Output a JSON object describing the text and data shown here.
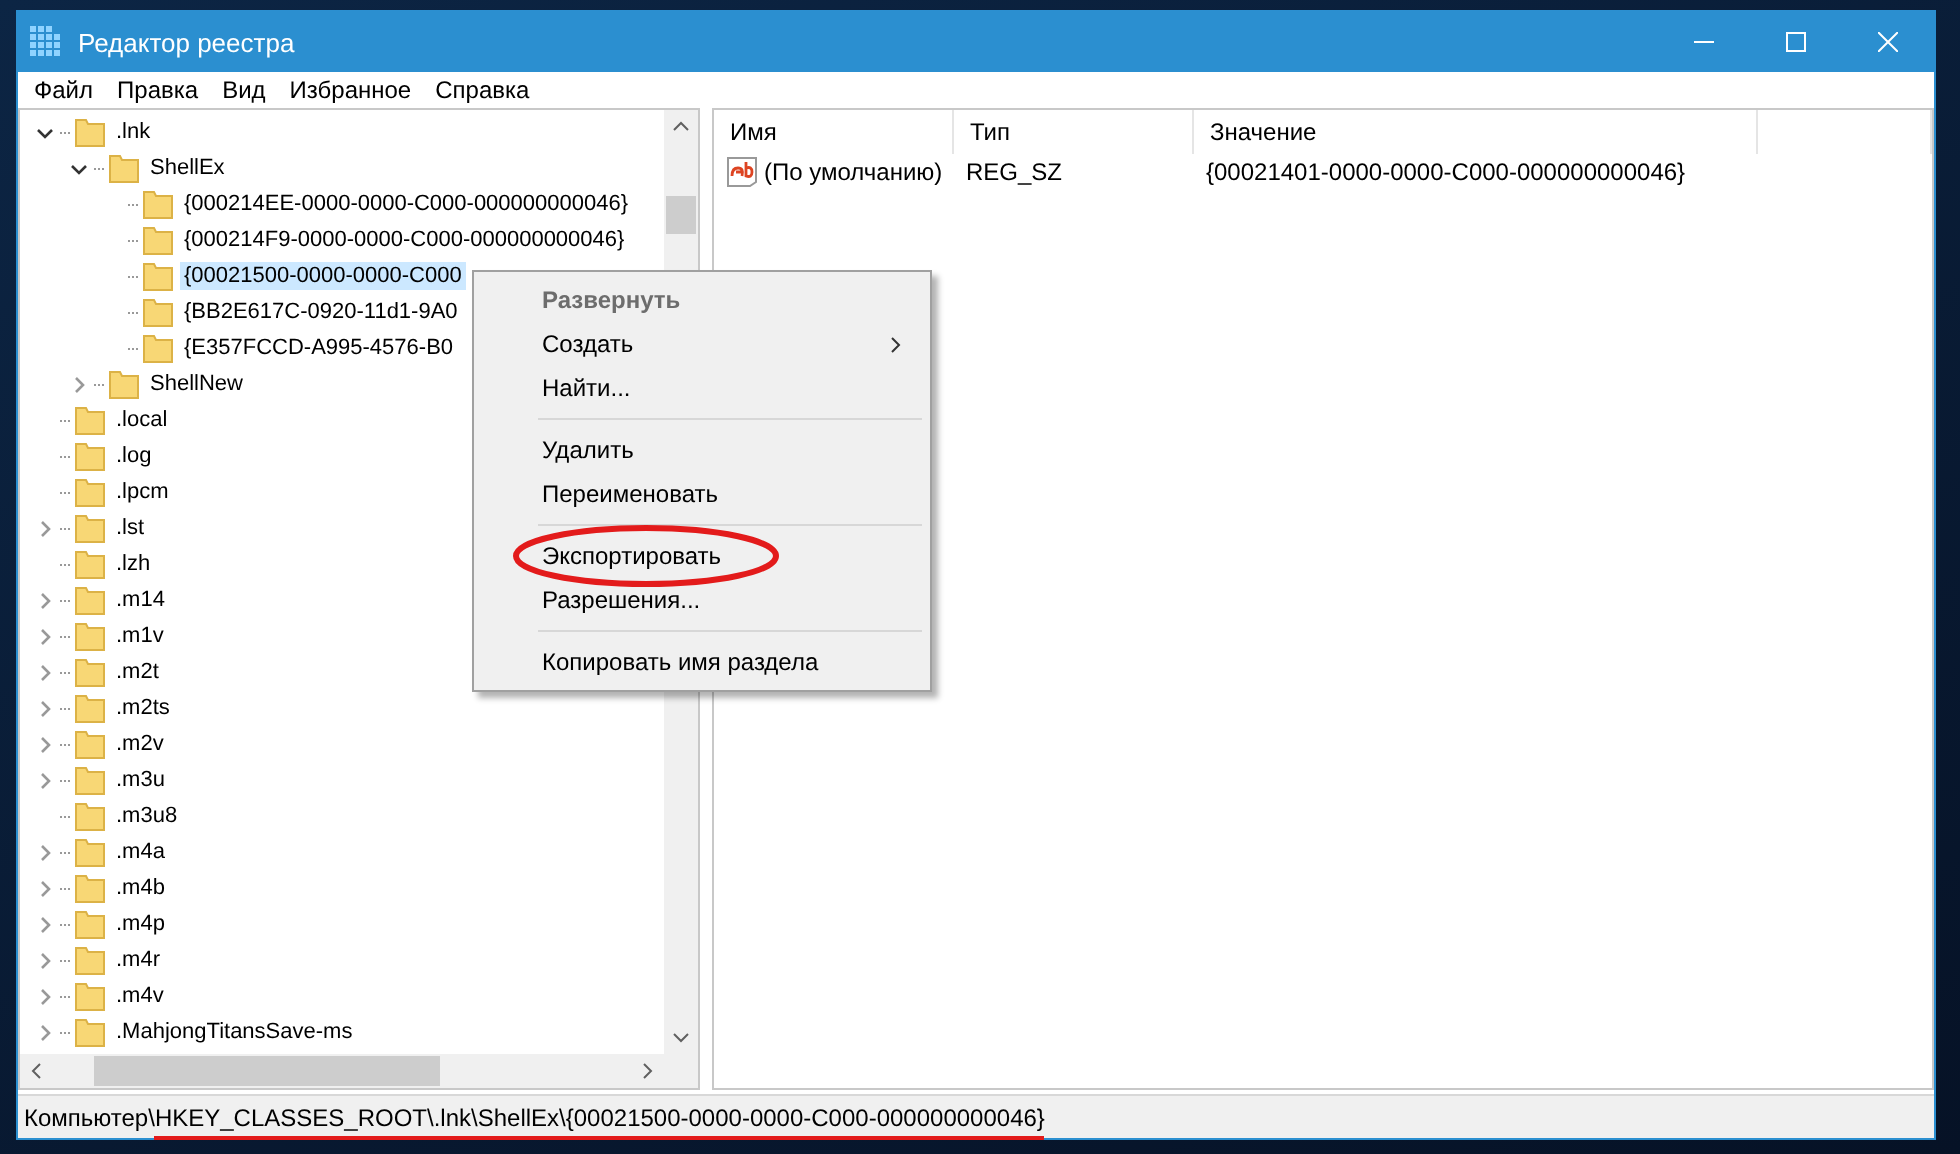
{
  "window": {
    "title": "Редактор реестра"
  },
  "menu_bar": [
    "Файл",
    "Правка",
    "Вид",
    "Избранное",
    "Справка"
  ],
  "tree": [
    {
      "label": ".lnk",
      "expanded": true,
      "selected": false,
      "children": [
        {
          "label": "ShellEx",
          "expanded": true,
          "selected": false,
          "children": [
            {
              "label": "{000214EE-0000-0000-C000-000000000046}",
              "selected": false
            },
            {
              "label": "{000214F9-0000-0000-C000-000000000046}",
              "selected": false
            },
            {
              "label": "{00021500-0000-0000-C000",
              "selected": true
            },
            {
              "label": "{BB2E617C-0920-11d1-9A0",
              "selected": false
            },
            {
              "label": "{E357FCCD-A995-4576-B0",
              "selected": false
            }
          ]
        },
        {
          "label": "ShellNew",
          "expanded": false,
          "selected": false
        }
      ]
    },
    {
      "label": ".local",
      "selected": false
    },
    {
      "label": ".log",
      "selected": false
    },
    {
      "label": ".lpcm",
      "selected": false
    },
    {
      "label": ".lst",
      "expanded": false,
      "selected": false
    },
    {
      "label": ".lzh",
      "selected": false
    },
    {
      "label": ".m14",
      "expanded": false,
      "selected": false
    },
    {
      "label": ".m1v",
      "expanded": false,
      "selected": false
    },
    {
      "label": ".m2t",
      "expanded": false,
      "selected": false
    },
    {
      "label": ".m2ts",
      "expanded": false,
      "selected": false
    },
    {
      "label": ".m2v",
      "expanded": false,
      "selected": false
    },
    {
      "label": ".m3u",
      "expanded": false,
      "selected": false
    },
    {
      "label": ".m3u8",
      "selected": false
    },
    {
      "label": ".m4a",
      "expanded": false,
      "selected": false
    },
    {
      "label": ".m4b",
      "expanded": false,
      "selected": false
    },
    {
      "label": ".m4p",
      "expanded": false,
      "selected": false
    },
    {
      "label": ".m4r",
      "expanded": false,
      "selected": false
    },
    {
      "label": ".m4v",
      "expanded": false,
      "selected": false
    },
    {
      "label": ".MahjongTitansSave-ms",
      "expanded": false,
      "selected": false
    }
  ],
  "context_menu": [
    {
      "kind": "item",
      "label": "Развернуть",
      "default": true,
      "disabled": true,
      "submenu": false,
      "highlighted": false
    },
    {
      "kind": "item",
      "label": "Создать",
      "default": false,
      "disabled": false,
      "submenu": true,
      "highlighted": false
    },
    {
      "kind": "item",
      "label": "Найти...",
      "default": false,
      "disabled": false,
      "submenu": false,
      "highlighted": false
    },
    {
      "kind": "separator"
    },
    {
      "kind": "item",
      "label": "Удалить",
      "default": false,
      "disabled": false,
      "submenu": false,
      "highlighted": false
    },
    {
      "kind": "item",
      "label": "Переименовать",
      "default": false,
      "disabled": false,
      "submenu": false,
      "highlighted": false
    },
    {
      "kind": "separator"
    },
    {
      "kind": "item",
      "label": "Экспортировать",
      "default": false,
      "disabled": false,
      "submenu": false,
      "highlighted": true
    },
    {
      "kind": "item",
      "label": "Разрешения...",
      "default": false,
      "disabled": false,
      "submenu": false,
      "highlighted": false
    },
    {
      "kind": "separator"
    },
    {
      "kind": "item",
      "label": "Копировать имя раздела",
      "default": false,
      "disabled": false,
      "submenu": false,
      "highlighted": false
    }
  ],
  "values_table": {
    "columns": [
      "Имя",
      "Тип",
      "Значение"
    ],
    "rows": [
      {
        "name": "(По умолчанию)",
        "type": "REG_SZ",
        "value": "{00021401-0000-0000-C000-000000000046}"
      }
    ]
  },
  "status_bar": {
    "prefix": "Компьютер\\",
    "path": "HKEY_CLASSES_ROOT\\.lnk\\ShellEx\\{00021500-0000-0000-C000-000000000046}",
    "highlighted": true
  }
}
